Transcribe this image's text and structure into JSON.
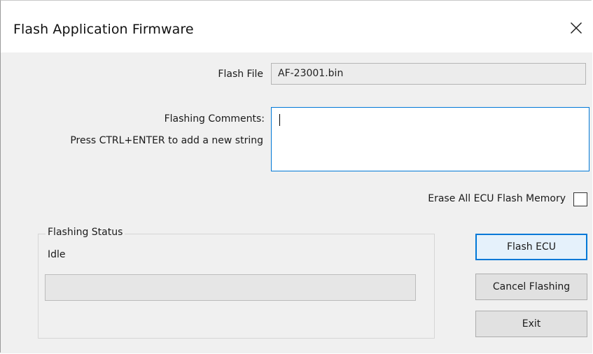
{
  "window": {
    "title": "Flash Application Firmware",
    "close_icon": "close-icon"
  },
  "form": {
    "flash_file_label": "Flash File",
    "flash_file_value": "AF-23001.bin",
    "comments_label": "Flashing Comments:",
    "comments_hint": "Press CTRL+ENTER to add a new string",
    "comments_value": "",
    "erase_label": "Erase All ECU Flash Memory",
    "erase_checked": false
  },
  "status_group": {
    "title": "Flashing Status",
    "status_text": "Idle",
    "progress_percent": 0
  },
  "buttons": {
    "flash": "Flash ECU",
    "cancel": "Cancel Flashing",
    "exit": "Exit"
  },
  "colors": {
    "focus_accent": "#0078d7",
    "progress_green": "#06b025"
  }
}
